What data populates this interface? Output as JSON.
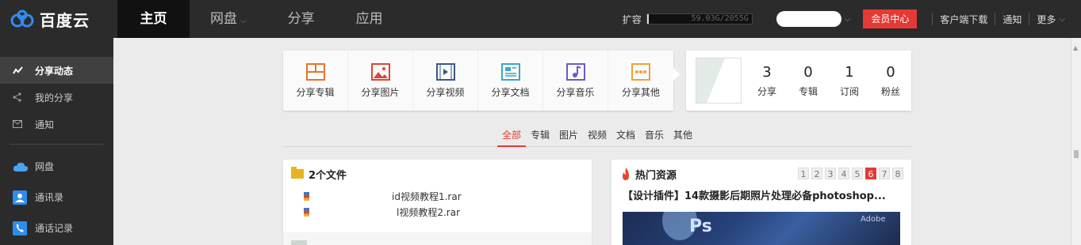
{
  "brand": {
    "name": "百度云"
  },
  "nav": {
    "items": [
      {
        "label": "主页"
      },
      {
        "label": "网盘"
      },
      {
        "label": "分享"
      },
      {
        "label": "应用"
      }
    ]
  },
  "topright": {
    "expand_label": "扩容",
    "quota_text": "59.03G/2055G",
    "vip_label": "会员中心",
    "download_label": "客户端下载",
    "notify_label": "通知",
    "more_label": "更多"
  },
  "sidebar": {
    "items": [
      {
        "label": "分享动态",
        "icon": "activity-icon"
      },
      {
        "label": "我的分享",
        "icon": "share-icon"
      },
      {
        "label": "通知",
        "icon": "mail-icon"
      },
      {
        "label": "网盘",
        "icon": "cloud-icon"
      },
      {
        "label": "通讯录",
        "icon": "contact-icon"
      },
      {
        "label": "通话记录",
        "icon": "phone-icon"
      }
    ]
  },
  "share_panel": {
    "items": [
      {
        "label": "分享专辑",
        "icon": "album-icon",
        "color": "#e8742a"
      },
      {
        "label": "分享图片",
        "icon": "image-icon",
        "color": "#d9473b"
      },
      {
        "label": "分享视频",
        "icon": "video-icon",
        "color": "#3d5a80"
      },
      {
        "label": "分享文档",
        "icon": "document-icon",
        "color": "#3aa6c8"
      },
      {
        "label": "分享音乐",
        "icon": "music-icon",
        "color": "#6a5acd"
      },
      {
        "label": "分享其他",
        "icon": "more-icon",
        "color": "#f0a13a"
      }
    ]
  },
  "stats": [
    {
      "value": "3",
      "label": "分享"
    },
    {
      "value": "0",
      "label": "专辑"
    },
    {
      "value": "1",
      "label": "订阅"
    },
    {
      "value": "0",
      "label": "粉丝"
    }
  ],
  "filter_tabs": [
    "全部",
    "专辑",
    "图片",
    "视频",
    "文档",
    "音乐",
    "其他"
  ],
  "files": {
    "title": "2个文件",
    "rows": [
      {
        "name": "id视频教程1.rar"
      },
      {
        "name": "l视频教程2.rar"
      }
    ]
  },
  "hot": {
    "title": "热门资源",
    "pages": [
      "1",
      "2",
      "3",
      "4",
      "5",
      "6",
      "7",
      "8"
    ],
    "active_page": "6",
    "item_title": "【设计插件】14款摄影后期照片处理必备photoshop...",
    "thumb_logo": "Ps",
    "thumb_mark": "Adobe"
  },
  "colors": {
    "accent": "#e53935",
    "topbar": "#2b2b2b",
    "page_bg": "#ebebeb"
  }
}
